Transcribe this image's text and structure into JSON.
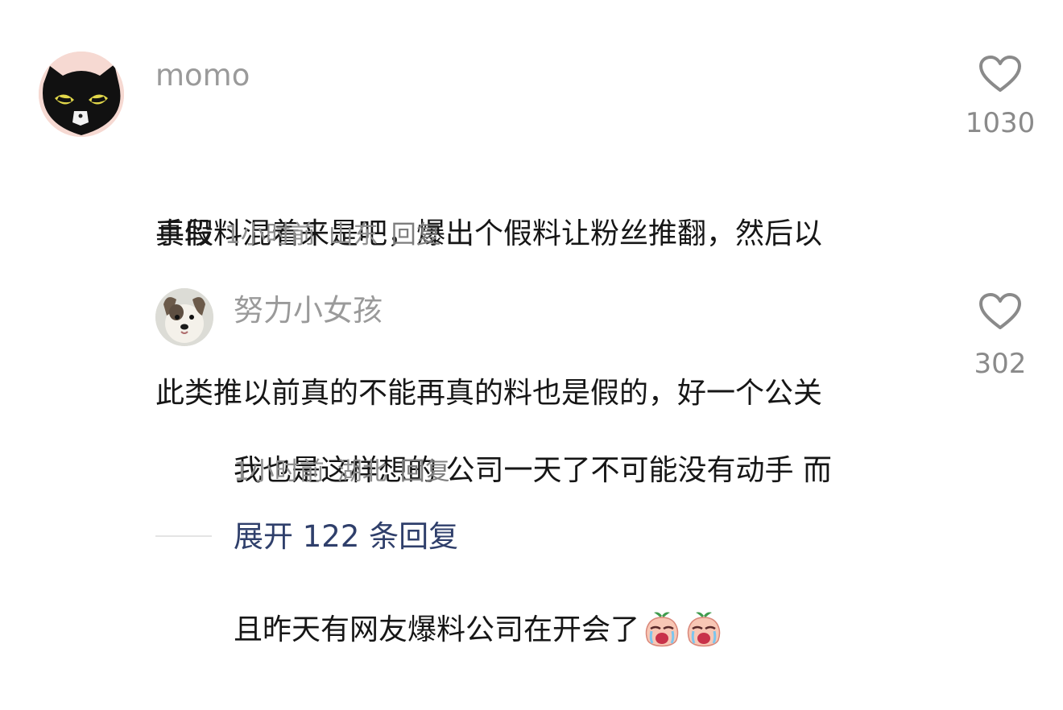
{
  "comment": {
    "username": "momo",
    "text_lines": [
      "真假料混着来是吧，爆出个假料让粉丝推翻，然后以",
      "此类推以前真的不能再真的料也是假的，好一个公关",
      "手段"
    ],
    "time": "1小时前",
    "location": "山东",
    "reply_label": "回复",
    "like_count": "1030",
    "avatar_icon": "black-cat-avatar"
  },
  "reply": {
    "username": "努力小女孩",
    "text_lines": [
      "我也是这样想的 公司一天了不可能没有动手 而",
      "且昨天有网友爆料公司在开会了"
    ],
    "emoji_icons": [
      "crying-peach-emoji",
      "crying-peach-emoji"
    ],
    "time": "1小时前",
    "location": "湖北",
    "reply_label": "回复",
    "like_count": "302",
    "avatar_icon": "puppy-avatar"
  },
  "expand": {
    "label": "展开 122 条回复"
  },
  "colors": {
    "username": "#9a9a9a",
    "text": "#161616",
    "meta": "#8f8f8f",
    "expand_link": "#2f3f6b",
    "heart_stroke": "#8a8a8a"
  }
}
